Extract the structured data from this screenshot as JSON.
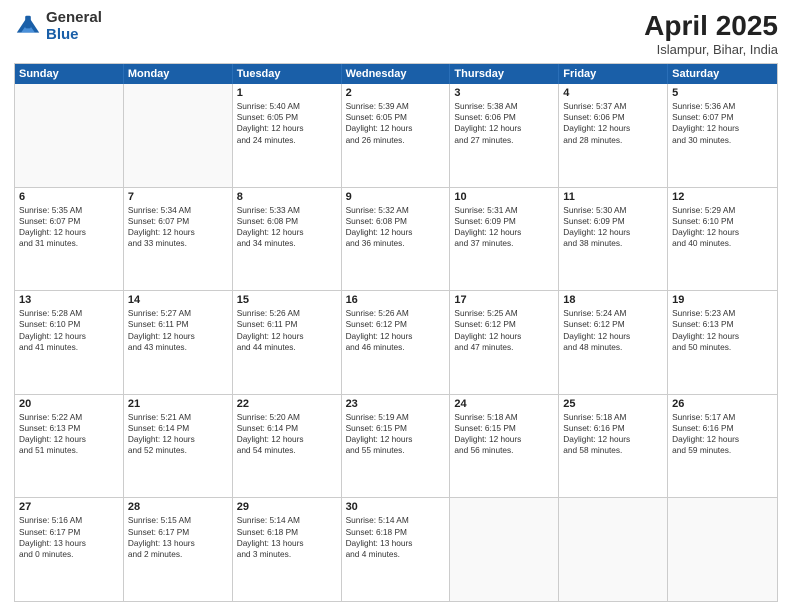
{
  "header": {
    "logo_general": "General",
    "logo_blue": "Blue",
    "month_title": "April 2025",
    "location": "Islampur, Bihar, India"
  },
  "days_of_week": [
    "Sunday",
    "Monday",
    "Tuesday",
    "Wednesday",
    "Thursday",
    "Friday",
    "Saturday"
  ],
  "rows": [
    [
      {
        "day": "",
        "content": []
      },
      {
        "day": "",
        "content": []
      },
      {
        "day": "1",
        "content": [
          "Sunrise: 5:40 AM",
          "Sunset: 6:05 PM",
          "Daylight: 12 hours",
          "and 24 minutes."
        ]
      },
      {
        "day": "2",
        "content": [
          "Sunrise: 5:39 AM",
          "Sunset: 6:05 PM",
          "Daylight: 12 hours",
          "and 26 minutes."
        ]
      },
      {
        "day": "3",
        "content": [
          "Sunrise: 5:38 AM",
          "Sunset: 6:06 PM",
          "Daylight: 12 hours",
          "and 27 minutes."
        ]
      },
      {
        "day": "4",
        "content": [
          "Sunrise: 5:37 AM",
          "Sunset: 6:06 PM",
          "Daylight: 12 hours",
          "and 28 minutes."
        ]
      },
      {
        "day": "5",
        "content": [
          "Sunrise: 5:36 AM",
          "Sunset: 6:07 PM",
          "Daylight: 12 hours",
          "and 30 minutes."
        ]
      }
    ],
    [
      {
        "day": "6",
        "content": [
          "Sunrise: 5:35 AM",
          "Sunset: 6:07 PM",
          "Daylight: 12 hours",
          "and 31 minutes."
        ]
      },
      {
        "day": "7",
        "content": [
          "Sunrise: 5:34 AM",
          "Sunset: 6:07 PM",
          "Daylight: 12 hours",
          "and 33 minutes."
        ]
      },
      {
        "day": "8",
        "content": [
          "Sunrise: 5:33 AM",
          "Sunset: 6:08 PM",
          "Daylight: 12 hours",
          "and 34 minutes."
        ]
      },
      {
        "day": "9",
        "content": [
          "Sunrise: 5:32 AM",
          "Sunset: 6:08 PM",
          "Daylight: 12 hours",
          "and 36 minutes."
        ]
      },
      {
        "day": "10",
        "content": [
          "Sunrise: 5:31 AM",
          "Sunset: 6:09 PM",
          "Daylight: 12 hours",
          "and 37 minutes."
        ]
      },
      {
        "day": "11",
        "content": [
          "Sunrise: 5:30 AM",
          "Sunset: 6:09 PM",
          "Daylight: 12 hours",
          "and 38 minutes."
        ]
      },
      {
        "day": "12",
        "content": [
          "Sunrise: 5:29 AM",
          "Sunset: 6:10 PM",
          "Daylight: 12 hours",
          "and 40 minutes."
        ]
      }
    ],
    [
      {
        "day": "13",
        "content": [
          "Sunrise: 5:28 AM",
          "Sunset: 6:10 PM",
          "Daylight: 12 hours",
          "and 41 minutes."
        ]
      },
      {
        "day": "14",
        "content": [
          "Sunrise: 5:27 AM",
          "Sunset: 6:11 PM",
          "Daylight: 12 hours",
          "and 43 minutes."
        ]
      },
      {
        "day": "15",
        "content": [
          "Sunrise: 5:26 AM",
          "Sunset: 6:11 PM",
          "Daylight: 12 hours",
          "and 44 minutes."
        ]
      },
      {
        "day": "16",
        "content": [
          "Sunrise: 5:26 AM",
          "Sunset: 6:12 PM",
          "Daylight: 12 hours",
          "and 46 minutes."
        ]
      },
      {
        "day": "17",
        "content": [
          "Sunrise: 5:25 AM",
          "Sunset: 6:12 PM",
          "Daylight: 12 hours",
          "and 47 minutes."
        ]
      },
      {
        "day": "18",
        "content": [
          "Sunrise: 5:24 AM",
          "Sunset: 6:12 PM",
          "Daylight: 12 hours",
          "and 48 minutes."
        ]
      },
      {
        "day": "19",
        "content": [
          "Sunrise: 5:23 AM",
          "Sunset: 6:13 PM",
          "Daylight: 12 hours",
          "and 50 minutes."
        ]
      }
    ],
    [
      {
        "day": "20",
        "content": [
          "Sunrise: 5:22 AM",
          "Sunset: 6:13 PM",
          "Daylight: 12 hours",
          "and 51 minutes."
        ]
      },
      {
        "day": "21",
        "content": [
          "Sunrise: 5:21 AM",
          "Sunset: 6:14 PM",
          "Daylight: 12 hours",
          "and 52 minutes."
        ]
      },
      {
        "day": "22",
        "content": [
          "Sunrise: 5:20 AM",
          "Sunset: 6:14 PM",
          "Daylight: 12 hours",
          "and 54 minutes."
        ]
      },
      {
        "day": "23",
        "content": [
          "Sunrise: 5:19 AM",
          "Sunset: 6:15 PM",
          "Daylight: 12 hours",
          "and 55 minutes."
        ]
      },
      {
        "day": "24",
        "content": [
          "Sunrise: 5:18 AM",
          "Sunset: 6:15 PM",
          "Daylight: 12 hours",
          "and 56 minutes."
        ]
      },
      {
        "day": "25",
        "content": [
          "Sunrise: 5:18 AM",
          "Sunset: 6:16 PM",
          "Daylight: 12 hours",
          "and 58 minutes."
        ]
      },
      {
        "day": "26",
        "content": [
          "Sunrise: 5:17 AM",
          "Sunset: 6:16 PM",
          "Daylight: 12 hours",
          "and 59 minutes."
        ]
      }
    ],
    [
      {
        "day": "27",
        "content": [
          "Sunrise: 5:16 AM",
          "Sunset: 6:17 PM",
          "Daylight: 13 hours",
          "and 0 minutes."
        ]
      },
      {
        "day": "28",
        "content": [
          "Sunrise: 5:15 AM",
          "Sunset: 6:17 PM",
          "Daylight: 13 hours",
          "and 2 minutes."
        ]
      },
      {
        "day": "29",
        "content": [
          "Sunrise: 5:14 AM",
          "Sunset: 6:18 PM",
          "Daylight: 13 hours",
          "and 3 minutes."
        ]
      },
      {
        "day": "30",
        "content": [
          "Sunrise: 5:14 AM",
          "Sunset: 6:18 PM",
          "Daylight: 13 hours",
          "and 4 minutes."
        ]
      },
      {
        "day": "",
        "content": []
      },
      {
        "day": "",
        "content": []
      },
      {
        "day": "",
        "content": []
      }
    ]
  ]
}
